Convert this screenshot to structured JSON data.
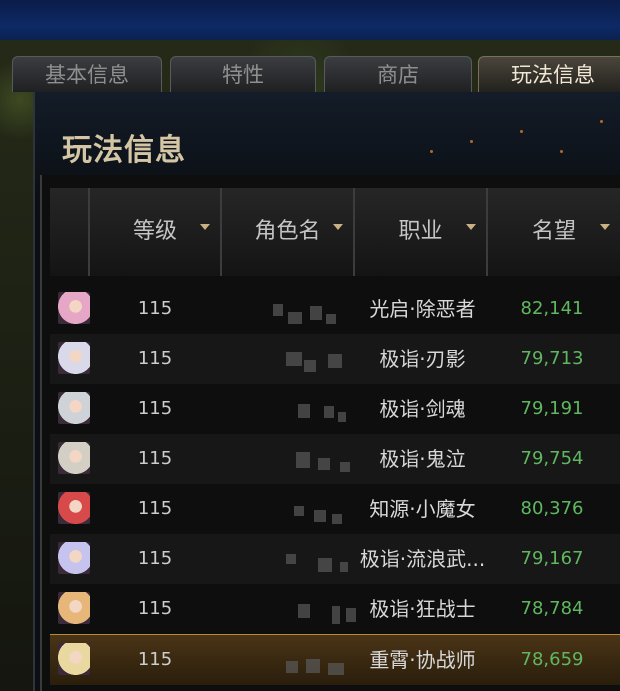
{
  "tabs": [
    {
      "label": "基本信息",
      "active": false
    },
    {
      "label": "特性",
      "active": false
    },
    {
      "label": "商店",
      "active": false
    },
    {
      "label": "玩法信息",
      "active": true
    }
  ],
  "panel": {
    "title": "玩法信息"
  },
  "table": {
    "columns": [
      {
        "label": "",
        "sortable": false
      },
      {
        "label": "等级",
        "sortable": true
      },
      {
        "label": "角色名",
        "sortable": true
      },
      {
        "label": "职业",
        "sortable": true
      },
      {
        "label": "名望",
        "sortable": true
      }
    ],
    "rows": [
      {
        "avatar": "female-priest-avatar-icon",
        "avatar_color": "#e6a7c6",
        "level": "115",
        "job": "光启·除恶者",
        "fame": "82,141",
        "selected": false
      },
      {
        "avatar": "white-hair-swordsman-avatar-icon",
        "avatar_color": "#d9d9ea",
        "level": "115",
        "job": "极诣·刃影",
        "fame": "79,713",
        "selected": false
      },
      {
        "avatar": "white-hair-swordsman-avatar-icon",
        "avatar_color": "#cfd2d6",
        "level": "115",
        "job": "极诣·剑魂",
        "fame": "79,191",
        "selected": false
      },
      {
        "avatar": "white-hair-slayer-avatar-icon",
        "avatar_color": "#d4cfc5",
        "level": "115",
        "job": "极诣·鬼泣",
        "fame": "79,754",
        "selected": false
      },
      {
        "avatar": "red-hair-mage-avatar-icon",
        "avatar_color": "#d84a4a",
        "level": "115",
        "job": "知源·小魔女",
        "fame": "80,376",
        "selected": false
      },
      {
        "avatar": "lavender-hair-swordswoman-avatar-icon",
        "avatar_color": "#c7c3ef",
        "level": "115",
        "job": "极诣·流浪武...",
        "fame": "79,167",
        "selected": false
      },
      {
        "avatar": "blonde-slayer-avatar-icon",
        "avatar_color": "#e7b77a",
        "level": "115",
        "job": "极诣·狂战士",
        "fame": "78,784",
        "selected": false
      },
      {
        "avatar": "blonde-knight-avatar-icon",
        "avatar_color": "#e9d9a0",
        "level": "115",
        "job": "重霄·协战师",
        "fame": "78,659",
        "selected": true
      }
    ]
  },
  "colors": {
    "accent_gold": "#c9b183",
    "fame_green": "#5fb85f",
    "selected_row": "#4a3416"
  }
}
